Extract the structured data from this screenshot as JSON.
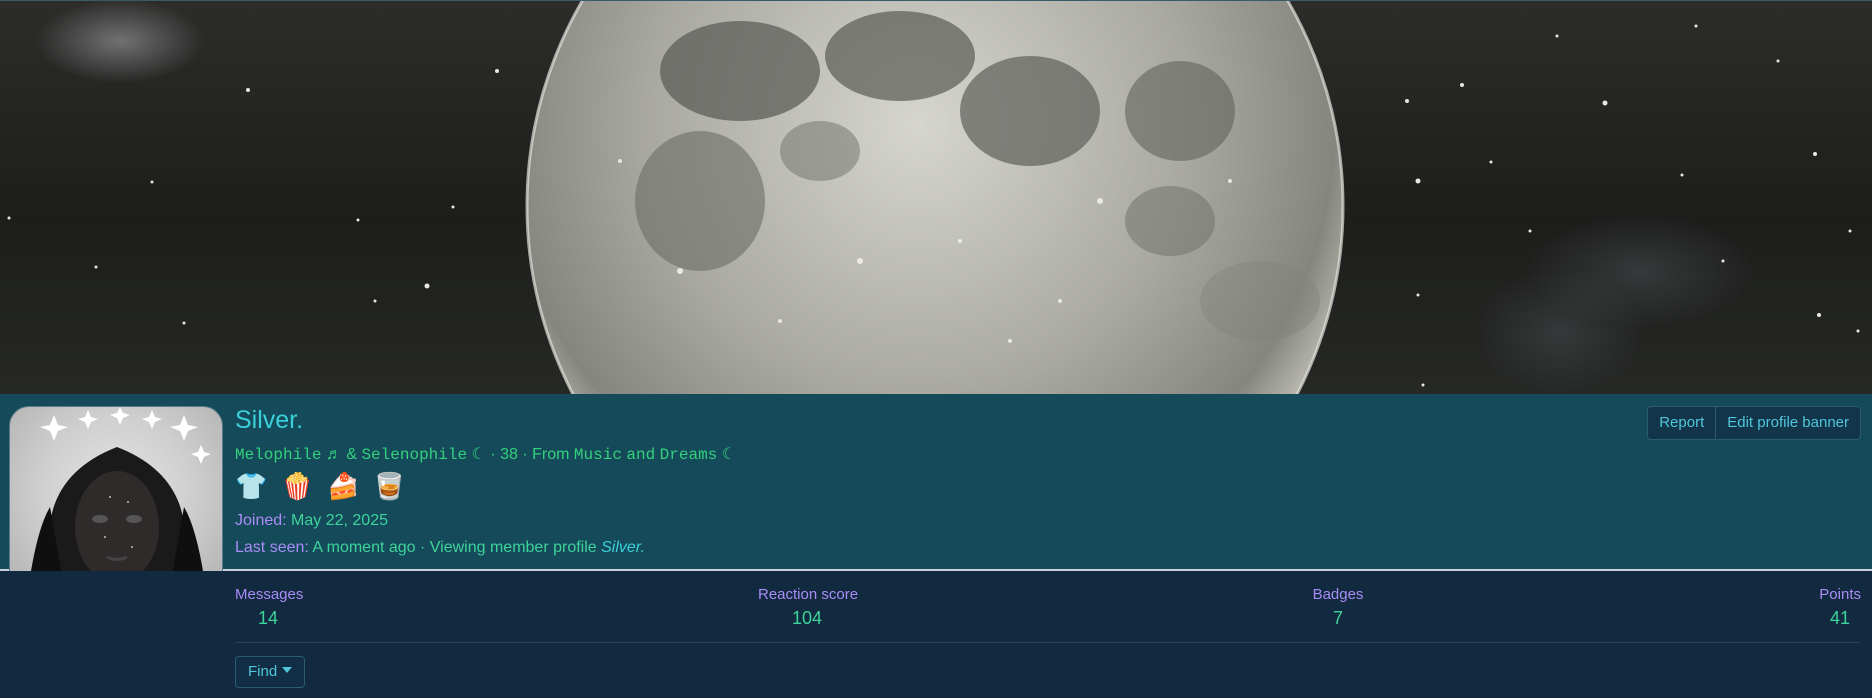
{
  "profile": {
    "username": "Silver.",
    "title_mono_1": "Melophile",
    "note_glyph": "♬",
    "amp": "&",
    "title_mono_2": "Selenophile",
    "moon_glyph": "☾",
    "age_sep": "·",
    "age": "38",
    "from_label": "From",
    "from_mono_1": "Music",
    "from_and": "and",
    "from_mono_2": "Dreams",
    "moon_glyph_2": "☾",
    "joined_label": "Joined:",
    "joined_value": "May 22, 2025",
    "last_seen_label": "Last seen:",
    "last_seen_value": "A moment ago · Viewing member profile",
    "last_seen_link": "Silver."
  },
  "awards": [
    {
      "icon": "tie-dye-shirt-icon",
      "glyph": "👕"
    },
    {
      "icon": "popcorn-icon",
      "glyph": "🍿"
    },
    {
      "icon": "cake-confetti-icon",
      "glyph": "🍰"
    },
    {
      "icon": "whiskey-glass-icon",
      "glyph": "🥃"
    }
  ],
  "actions": {
    "report": "Report",
    "edit_banner": "Edit profile banner"
  },
  "stats": {
    "messages": {
      "label": "Messages",
      "value": "14"
    },
    "reaction_score": {
      "label": "Reaction score",
      "value": "104"
    },
    "badges": {
      "label": "Badges",
      "value": "7"
    },
    "points": {
      "label": "Points",
      "value": "41"
    }
  },
  "find": {
    "label": "Find"
  },
  "colors": {
    "header_bg": "#154a5a",
    "stats_bg": "#112a40",
    "username": "#3ad0d8",
    "label_purple": "#a98cf5",
    "value_green": "#3dd39a"
  }
}
